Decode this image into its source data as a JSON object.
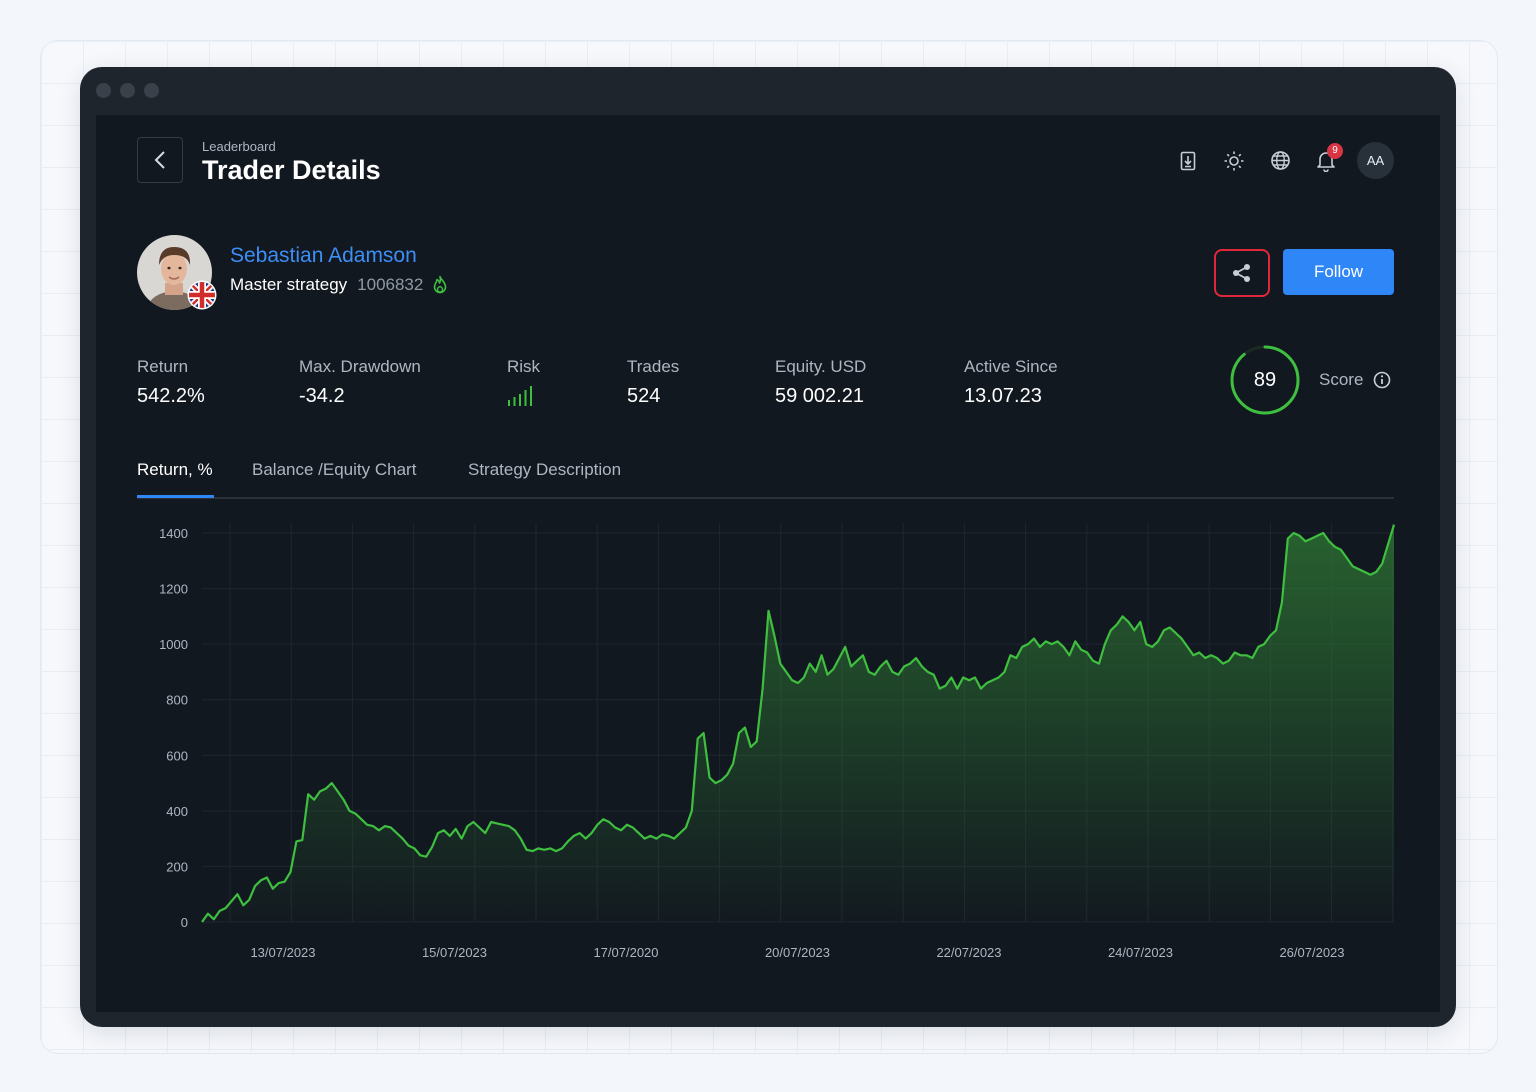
{
  "header": {
    "breadcrumb": "Leaderboard",
    "title": "Trader Details",
    "notification_count": "9",
    "user_initials": "AA",
    "icons": [
      "report-icon",
      "sun-icon",
      "globe-icon",
      "bell-icon"
    ]
  },
  "trader": {
    "name": "Sebastian Adamson",
    "strategy": "Master strategy",
    "account_id": "1006832",
    "country_flag": "united-kingdom-flag-icon",
    "badge_icon": "fire-icon"
  },
  "actions": {
    "share_icon": "share-icon",
    "follow_label": "Follow"
  },
  "stats": {
    "return": {
      "label": "Return",
      "value": "542.2%"
    },
    "drawdown": {
      "label": "Max. Drawdown",
      "value": "-34.2"
    },
    "risk": {
      "label": "Risk",
      "bars_filled": 5,
      "bars_total": 5
    },
    "trades": {
      "label": "Trades",
      "value": "524"
    },
    "equity": {
      "label": "Equity. USD",
      "value": "59 002.21"
    },
    "active_since": {
      "label": "Active Since",
      "value": "13.07.23"
    }
  },
  "score": {
    "value": "89",
    "label": "Score",
    "max": 100
  },
  "tabs": [
    {
      "label": "Return, %",
      "active": true
    },
    {
      "label": "Balance /Equity Chart",
      "active": false
    },
    {
      "label": "Strategy Description",
      "active": false
    }
  ],
  "colors": {
    "accent": "#2f86f6",
    "positive": "#3fbf3f",
    "danger": "#e0283a",
    "background": "#121820"
  },
  "chart_data": {
    "type": "area",
    "title": "",
    "xlabel": "",
    "ylabel": "",
    "ylim": [
      0,
      1400
    ],
    "yticks": [
      "0",
      "200",
      "400",
      "600",
      "800",
      "1000",
      "1200",
      "1400"
    ],
    "xticks": [
      "13/07/2023",
      "15/07/2023",
      "17/07/2020",
      "20/07/2023",
      "22/07/2023",
      "24/07/2023",
      "26/07/2023"
    ],
    "grid": true,
    "series": [
      {
        "values": [
          0,
          30,
          10,
          40,
          50,
          75,
          100,
          60,
          80,
          130,
          150,
          160,
          120,
          140,
          145,
          180,
          290,
          295,
          460,
          440,
          470,
          480,
          500,
          470,
          440,
          400,
          390,
          370,
          350,
          345,
          330,
          345,
          340,
          320,
          300,
          275,
          265,
          240,
          235,
          270,
          320,
          330,
          310,
          335,
          300,
          345,
          360,
          340,
          320,
          360,
          355,
          350,
          345,
          330,
          300,
          260,
          255,
          265,
          260,
          265,
          255,
          265,
          290,
          310,
          320,
          300,
          320,
          350,
          370,
          360,
          340,
          330,
          350,
          340,
          320,
          300,
          310,
          300,
          315,
          310,
          300,
          320,
          340,
          400,
          660,
          680,
          520,
          500,
          510,
          530,
          570,
          680,
          700,
          630,
          650,
          840,
          1120,
          1030,
          930,
          900,
          870,
          860,
          880,
          930,
          900,
          960,
          890,
          910,
          950,
          990,
          920,
          940,
          960,
          900,
          890,
          920,
          940,
          900,
          890,
          920,
          930,
          950,
          920,
          900,
          890,
          840,
          850,
          880,
          840,
          880,
          870,
          880,
          840,
          860,
          870,
          880,
          900,
          960,
          950,
          990,
          1000,
          1020,
          990,
          1010,
          1000,
          1010,
          990,
          960,
          1010,
          980,
          970,
          940,
          930,
          1000,
          1050,
          1070,
          1100,
          1080,
          1050,
          1080,
          1000,
          990,
          1010,
          1050,
          1060,
          1040,
          1020,
          990,
          960,
          970,
          950,
          960,
          950,
          930,
          940,
          970,
          960,
          960,
          950,
          990,
          1000,
          1030,
          1050,
          1150,
          1380,
          1400,
          1390,
          1370,
          1380,
          1390,
          1400,
          1370,
          1350,
          1340,
          1310,
          1280,
          1270,
          1260,
          1250,
          1260,
          1290,
          1360,
          1430
        ]
      }
    ]
  }
}
